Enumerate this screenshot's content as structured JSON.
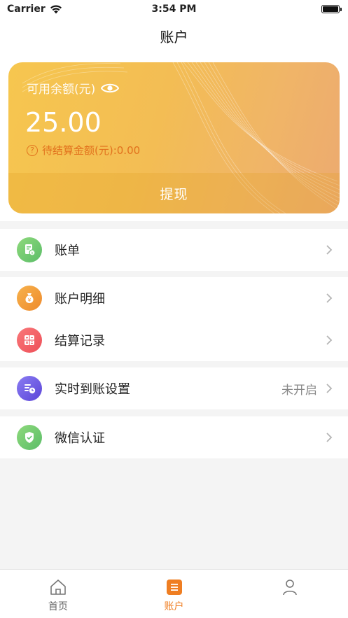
{
  "status": {
    "carrier": "Carrier",
    "time": "3:54 PM"
  },
  "nav": {
    "title": "账户"
  },
  "card": {
    "balance_label": "可用余额(元)",
    "balance": "25.00",
    "pending": "待结算金额(元):0.00",
    "withdraw": "提现",
    "colors": {
      "gradient_start": "#f6c64f",
      "gradient_end": "#ecaa70",
      "pending_text": "#e2711d"
    }
  },
  "menu": {
    "bill": {
      "label": "账单",
      "icon": "bill-icon"
    },
    "detail": {
      "label": "账户明细",
      "icon": "moneybag-icon"
    },
    "settle": {
      "label": "结算记录",
      "icon": "calculator-icon"
    },
    "realtime": {
      "label": "实时到账设置",
      "value": "未开启",
      "icon": "clock-list-icon"
    },
    "wechat": {
      "label": "微信认证",
      "icon": "shield-check-icon"
    }
  },
  "tabs": [
    {
      "label": "首页",
      "icon": "home-icon",
      "active": false
    },
    {
      "label": "账户",
      "icon": "list-icon",
      "active": true
    },
    {
      "label": "",
      "icon": "user-icon",
      "active": false
    }
  ],
  "colors": {
    "accent": "#ef7e22",
    "background": "#f4f4f4"
  }
}
